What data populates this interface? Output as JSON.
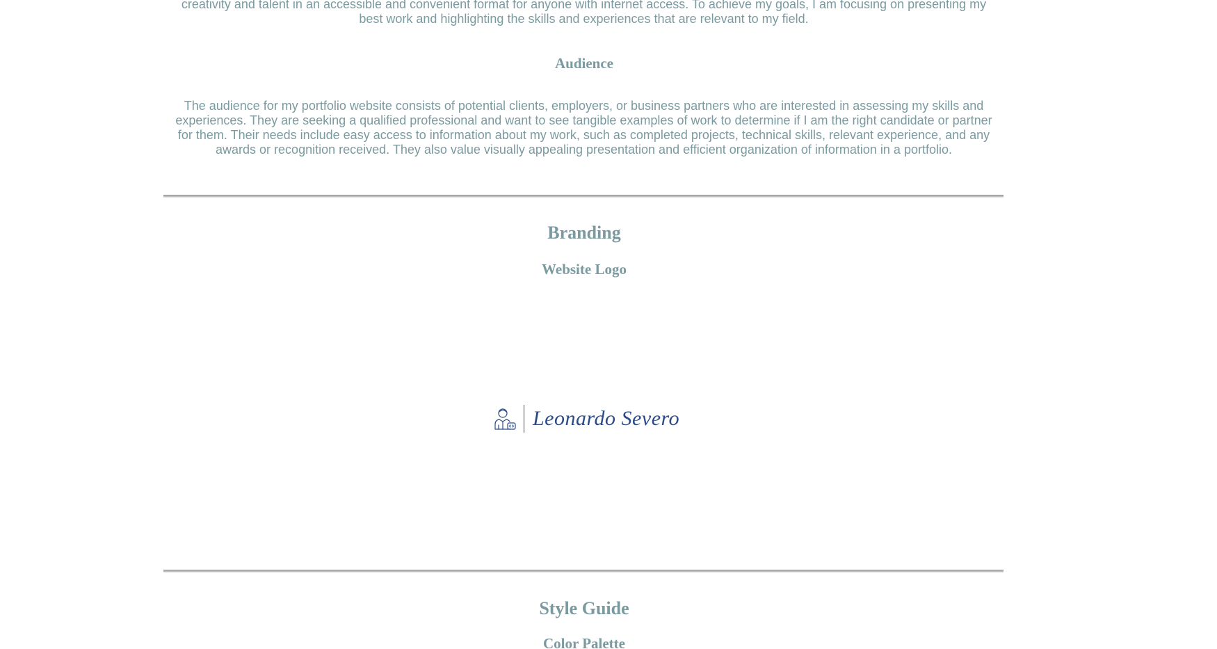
{
  "intro": {
    "line_1": "creativity and talent in an accessible and convenient format for anyone with internet access. To achieve my goals, I am focusing on presenting my",
    "line_2": "best work and highlighting the skills and experiences that are relevant to my field."
  },
  "audience": {
    "heading": "Audience",
    "paragraph": "The audience for my portfolio website consists of potential clients, employers, or business partners who are interested in assessing my skills and experiences. They are seeking a qualified professional and want to see tangible examples of work to determine if I am the right candidate or partner for them. Their needs include easy access to information about my work, such as completed projects, technical skills, relevant experience, and any awards or recognition received. They also value visually appealing presentation and efficient organization of information in a portfolio."
  },
  "branding": {
    "heading": "Branding",
    "subheading": "Website Logo",
    "logo": {
      "icon": "developer-person-icon",
      "name": "Leonardo Severo",
      "color": "#2b4a87"
    }
  },
  "style_guide": {
    "heading": "Style Guide",
    "subheading": "Color Palette"
  },
  "colors": {
    "text": "#7a9aa0",
    "brand": "#2b4a87",
    "background": "#ffffff"
  }
}
